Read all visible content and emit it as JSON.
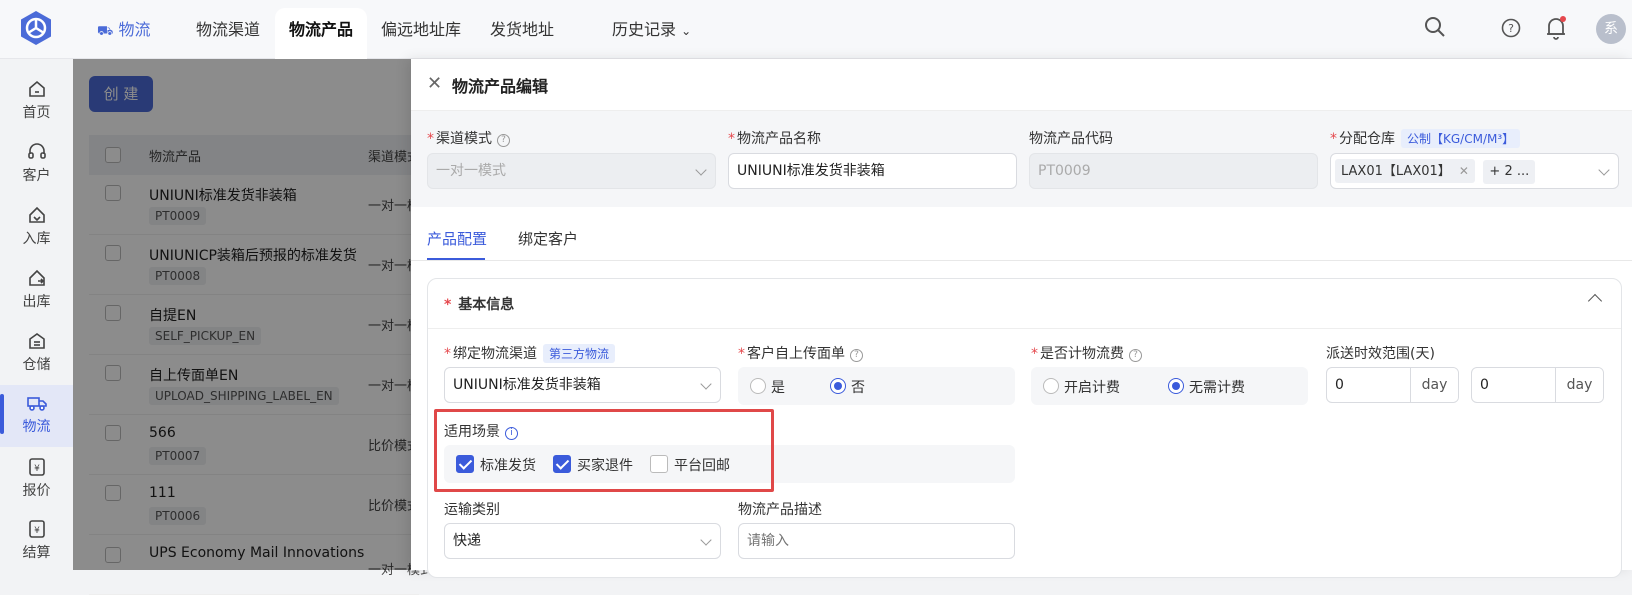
{
  "topnav": {
    "brand": "物流",
    "items": [
      "物流渠道",
      "物流产品",
      "偏远地址库",
      "发货地址"
    ],
    "history": "历史记录",
    "avatar_text": "系"
  },
  "sidebar": {
    "items": [
      {
        "label": "首页",
        "icon": "home-icon"
      },
      {
        "label": "客户",
        "icon": "headset-icon"
      },
      {
        "label": "入库",
        "icon": "inbound-icon"
      },
      {
        "label": "出库",
        "icon": "outbound-icon"
      },
      {
        "label": "仓储",
        "icon": "warehouse-icon"
      },
      {
        "label": "物流",
        "icon": "truck-icon"
      },
      {
        "label": "报价",
        "icon": "quote-icon"
      },
      {
        "label": "结算",
        "icon": "settlement-icon"
      }
    ],
    "active": "物流"
  },
  "list": {
    "create_label": "创 建",
    "headers": [
      "物流产品",
      "渠道模式"
    ],
    "rows": [
      {
        "name": "UNIUNI标准发货非装箱",
        "code": "PT0009",
        "mode": "一对一模式"
      },
      {
        "name": "UNIUNICP装箱后预报的标准发货",
        "code": "PT0008",
        "mode": "一对一模式"
      },
      {
        "name": "自提EN",
        "code": "SELF_PICKUP_EN",
        "mode": "一对一模式"
      },
      {
        "name": "自上传面单EN",
        "code": "UPLOAD_SHIPPING_LABEL_EN",
        "mode": "一对一模式"
      },
      {
        "name": "566",
        "code": "PT0007",
        "mode": "比价模式"
      },
      {
        "name": "111",
        "code": "PT0006",
        "mode": "比价模式"
      },
      {
        "name": "UPS Economy Mail Innovations",
        "code": "",
        "mode": "一对一模式"
      }
    ]
  },
  "drawer": {
    "title": "物流产品编辑",
    "channel_mode": {
      "label": "渠道模式",
      "value": "一对一模式"
    },
    "product_name": {
      "label": "物流产品名称",
      "value": "UNIUNI标准发货非装箱"
    },
    "product_code": {
      "label": "物流产品代码",
      "value": "PT0009"
    },
    "warehouse": {
      "label": "分配仓库",
      "unit_tag": "公制【KG/CM/M³】",
      "tag": "LAX01【LAX01】",
      "more": "+ 2 ..."
    },
    "tabs": [
      "产品配置",
      "绑定客户"
    ],
    "section_title": "基本信息",
    "bind_channel": {
      "label": "绑定物流渠道",
      "tag": "第三方物流",
      "value": "UNIUNI标准发货非装箱"
    },
    "self_label": {
      "label": "客户自上传面单",
      "options": [
        "是",
        "否"
      ],
      "selected": "否"
    },
    "charge_fee": {
      "label": "是否计物流费",
      "options": [
        "开启计费",
        "无需计费"
      ],
      "selected": "无需计费"
    },
    "delivery_range": {
      "label": "派送时效范围(天)",
      "min": "0",
      "max": "0",
      "unit": "day"
    },
    "scenarios": {
      "label": "适用场景",
      "options": [
        {
          "label": "标准发货",
          "checked": true
        },
        {
          "label": "买家退件",
          "checked": true
        },
        {
          "label": "平台回邮",
          "checked": false
        }
      ]
    },
    "transport_type": {
      "label": "运输类别",
      "value": "快递"
    },
    "description": {
      "label": "物流产品描述",
      "placeholder": "请输入"
    }
  }
}
